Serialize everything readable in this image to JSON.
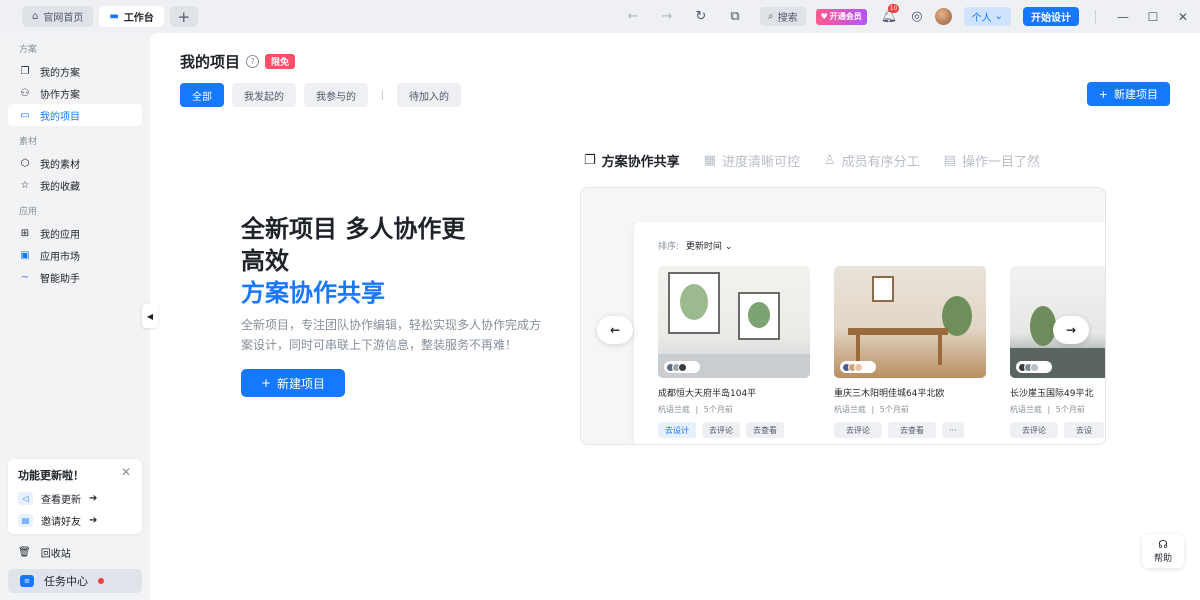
{
  "topbar": {
    "tabs": [
      {
        "label": "官网首页",
        "icon": "home-icon"
      },
      {
        "label": "工作台",
        "icon": "monitor-icon"
      }
    ],
    "search_label": "搜索",
    "vip_label": "开通会员",
    "notification_count": "10",
    "workspace_label": "个人",
    "start_design_label": "开始设计"
  },
  "sidebar": {
    "sections": [
      {
        "label": "方案",
        "items": [
          {
            "label": "我的方案",
            "icon": "copy-icon"
          },
          {
            "label": "协作方案",
            "icon": "team-icon"
          },
          {
            "label": "我的项目",
            "icon": "folder-icon",
            "active": true
          }
        ]
      },
      {
        "label": "素材",
        "items": [
          {
            "label": "我的素材",
            "icon": "cube-icon"
          },
          {
            "label": "我的收藏",
            "icon": "star-icon"
          }
        ]
      },
      {
        "label": "应用",
        "items": [
          {
            "label": "我的应用",
            "icon": "grid-icon"
          },
          {
            "label": "应用市场",
            "icon": "market-icon"
          },
          {
            "label": "智能助手",
            "icon": "ai-icon"
          }
        ]
      }
    ],
    "update_card": {
      "title": "功能更新啦！",
      "view_updates": "查看更新",
      "invite_friends": "邀请好友"
    },
    "trash_label": "回收站",
    "task_center_label": "任务中心"
  },
  "main": {
    "title": "我的项目",
    "limit_badge": "限免",
    "filters": [
      "全部",
      "我发起的",
      "我参与的",
      "待加入的"
    ],
    "new_project_label": "新建项目",
    "feature_tabs": [
      "方案协作共享",
      "进度清晰可控",
      "成员有序分工",
      "操作一目了然"
    ],
    "hero": {
      "headline_line1": "全新项目 多人协作更",
      "headline_line2": "高效",
      "highlight": "方案协作共享",
      "description": "全新项目，专注团队协作编辑，轻松实现多人协作完成方案设计，同时可串联上下游信息，整装服务不再难！",
      "button_label": "新建项目"
    },
    "preview": {
      "sort_label": "排序:",
      "sort_value": "更新时间",
      "cards": [
        {
          "title": "成都恒大天府半岛104平",
          "owner": "杭语兰庭",
          "time": "5个月前",
          "actions": [
            "去设计",
            "去评论",
            "去查看"
          ]
        },
        {
          "title": "重庆三木阳明佳城64平北欧",
          "owner": "杭语兰庭",
          "time": "5个月前",
          "actions": [
            "去评论",
            "去查看",
            "···"
          ]
        },
        {
          "title": "长沙崖玉国际49平北",
          "owner": "杭语兰庭",
          "time": "5个月前",
          "actions": [
            "去评论",
            "去设"
          ]
        }
      ]
    },
    "help_label": "帮助"
  },
  "colors": {
    "accent": "#1677ff",
    "limit_badge": "#ff4d6a",
    "sidebar_bg": "#f2f3f5"
  }
}
